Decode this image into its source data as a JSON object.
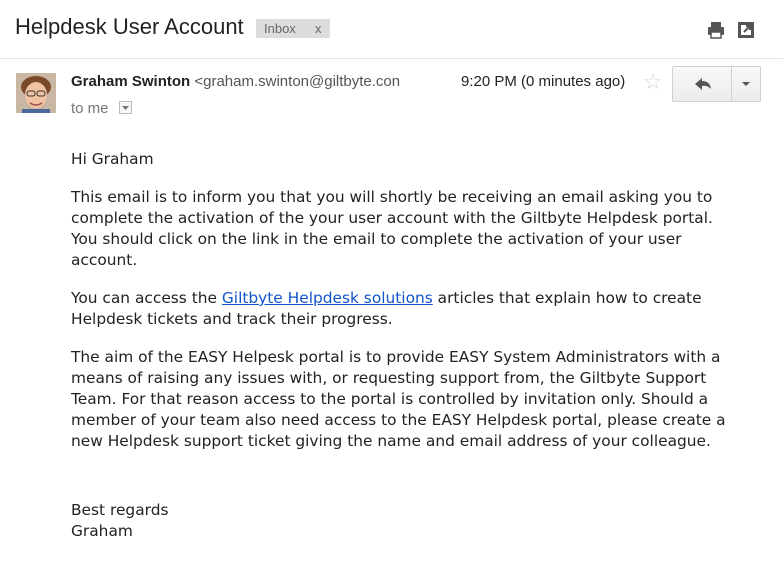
{
  "email": {
    "subject": "Helpdesk User Account",
    "label": "Inbox",
    "label_remove": "x",
    "sender_name": "Graham Swinton",
    "sender_email": "<graham.swinton@giltbyte.con",
    "time": "9:20 PM (0 minutes ago)",
    "to": "to me",
    "body": {
      "greeting": "Hi Graham",
      "para1": "This email is to inform you that you will shortly be receiving an email asking you to complete the activation of the your user account with the Giltbyte Helpdesk portal. You should click on the link in the email to complete the activation of your user account.",
      "para2_before": "You can access the ",
      "para2_link": "Giltbyte Helpdesk solutions",
      "para2_after": " articles that explain how to create Helpdesk tickets and track their progress.",
      "para3": "The aim of the EASY Helpesk portal is to provide EASY System Administrators with a means of raising any issues with, or requesting support from, the Giltbyte Support Team. For that reason access to the portal is controlled by invitation only. Should a member of your team also need access to the EASY Helpdesk portal, please create a new Helpdesk support ticket giving the name and email address of your colleague.",
      "signoff": "Best regards",
      "signature": "Graham"
    }
  },
  "icons": {
    "print": "print-icon",
    "popout": "popout-icon",
    "star": "star-icon",
    "reply": "reply-icon",
    "more": "chevron-down-icon"
  },
  "colors": {
    "link": "#1155cc",
    "chip_bg": "#dddddd"
  }
}
